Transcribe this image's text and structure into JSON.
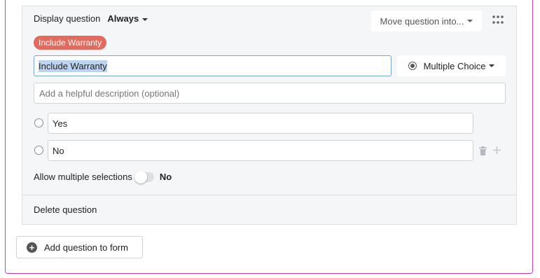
{
  "question": {
    "display_label": "Display question",
    "display_value": "Always",
    "move_label": "Move question into...",
    "badge": "Include Warranty",
    "title_value": "Include Warranty",
    "type_label": "Multiple Choice",
    "description_placeholder": "Add a helpful description (optional)",
    "options": [
      {
        "value": "Yes"
      },
      {
        "value": "No"
      }
    ],
    "allow_multiple_label": "Allow multiple selections",
    "allow_multiple_value": "No",
    "delete_label": "Delete question"
  },
  "add_question_label": "Add question to form",
  "colors": {
    "badge": "#e46a5e",
    "frame_border": "#d63ab0",
    "focus_border": "#7aa7d9",
    "card_bg": "#f5f6f8"
  }
}
